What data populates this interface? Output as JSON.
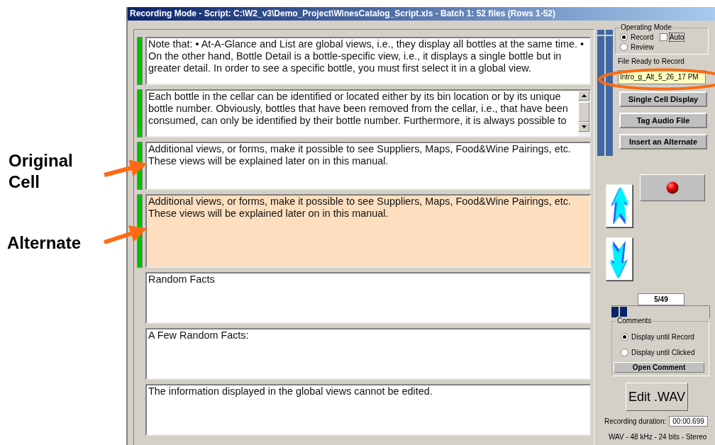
{
  "window": {
    "title": "Recording Mode - Script: C:\\W2_v3\\Demo_Project\\WinesCatalog_Script.xls - Batch 1: 52 files (Rows 1-52)"
  },
  "annotations": [
    {
      "kind": "callout",
      "text": "Original Cell"
    },
    {
      "kind": "callout",
      "text": "Alternate"
    }
  ],
  "cells": [
    {
      "kind": "original",
      "marked": true,
      "scrollable": false,
      "text": "Note that: • At-A-Glance and List are global views, i.e., they display all bottles at the same time. • On the other hand, Bottle Detail is a bottle-specific view, i.e., it displays a single bottle but in greater detail. In order to see a specific bottle, you must first select it in a global view."
    },
    {
      "kind": "original",
      "marked": true,
      "scrollable": true,
      "text": "Each bottle in the cellar can be identified or located either by its bin location or by its unique bottle number. Obviously, bottles that have been removed from the cellar, i.e., that have been consumed, can only be identified by their bottle number. Furthermore, it is always possible to"
    },
    {
      "kind": "original",
      "marked": true,
      "scrollable": false,
      "text": "Additional views, or forms, make it possible to see Suppliers, Maps, Food&Wine Pairings, etc. These views will be explained later on in this manual."
    },
    {
      "kind": "alternate",
      "marked": true,
      "scrollable": false,
      "text": "Additional views, or forms, make it possible to see Suppliers, Maps, Food&Wine Pairings, etc. These views will be explained later on in this manual."
    },
    {
      "kind": "original",
      "marked": false,
      "scrollable": false,
      "text": "Random Facts"
    },
    {
      "kind": "original",
      "marked": false,
      "scrollable": false,
      "text": "A Few Random Facts:"
    },
    {
      "kind": "original",
      "marked": false,
      "scrollable": false,
      "text": "The information displayed in the global views cannot be edited."
    }
  ],
  "meters": [
    {
      "level": 1
    },
    {
      "level": 1
    }
  ],
  "operating_mode": {
    "title": "Operating Mode",
    "options": [
      {
        "label": "Record",
        "selected": true
      },
      {
        "label": "Review",
        "selected": false
      }
    ],
    "auto": {
      "label": "Auto",
      "checked": false
    }
  },
  "file_ready": {
    "title": "File Ready to Record",
    "value": "Intro_g_Alt_5_26_17 PM"
  },
  "buttons": [
    "Single Cell Display",
    "Tag Audio File",
    "Insert an Alternate"
  ],
  "counter": "5/49",
  "progress": {
    "level": 0.17
  },
  "comments": {
    "title": "Comments",
    "options": [
      {
        "label": "Display until Record",
        "selected": true
      },
      {
        "label": "Display until Clicked",
        "selected": false
      }
    ],
    "button": "Open Comment"
  },
  "edit_button": "Edit .WAV",
  "duration": {
    "label": "Recording duration:",
    "value": "00:00.699"
  },
  "format": "WAV - 48 kHz - 24 bits - Stereo"
}
